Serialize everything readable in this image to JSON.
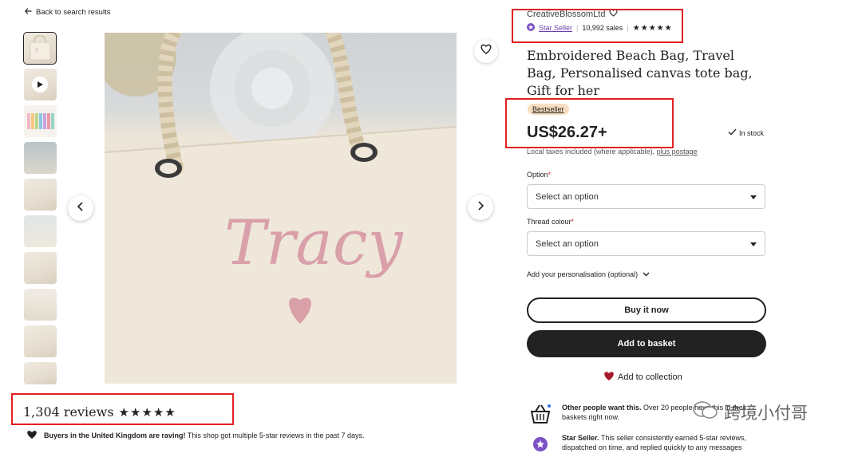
{
  "nav": {
    "back_label": "Back to search results"
  },
  "gallery": {
    "thumbnail_count": 10,
    "photo_text": "Tracy"
  },
  "shop": {
    "name": "CreativeBlossomLtd",
    "badge": "Star Seller",
    "sales": "10,992 sales",
    "rating_stars": 5
  },
  "listing": {
    "title": "Embroidered Beach Bag, Travel Bag, Personalised canvas tote bag, Gift for her",
    "bestseller_badge": "Bestseller",
    "price": "US$26.27+",
    "stock": "In stock",
    "taxes_text": "Local taxes included (where applicable),",
    "postage_link": "plus postage"
  },
  "form": {
    "option_label": "Option",
    "option_value": "Select an option",
    "thread_label": "Thread colour",
    "thread_value": "Select an option",
    "personalisation": "Add your personalisation (optional)",
    "required_mark": "*"
  },
  "actions": {
    "buy_now": "Buy it now",
    "add_to_basket": "Add to basket",
    "add_to_collection": "Add to collection"
  },
  "reviews": {
    "count_label": "1,304 reviews",
    "stars": 5,
    "raving_bold": "Buyers in the United Kingdom are raving!",
    "raving_text": "This shop got multiple 5-star reviews in the past 7 days."
  },
  "highlights": [
    {
      "bold": "Other people want this.",
      "text": "Over 20 people have this in their baskets right now."
    },
    {
      "bold": "Star Seller.",
      "text": "This seller consistently earned 5-star reviews, dispatched on time, and replied quickly to any messages"
    }
  ],
  "watermark": "跨境小付哥",
  "colors": {
    "accent_red": "#e02020",
    "star_seller_purple": "#6a3fb0",
    "bestseller_bg": "#f8ddc1",
    "primary_dark": "#222222"
  }
}
